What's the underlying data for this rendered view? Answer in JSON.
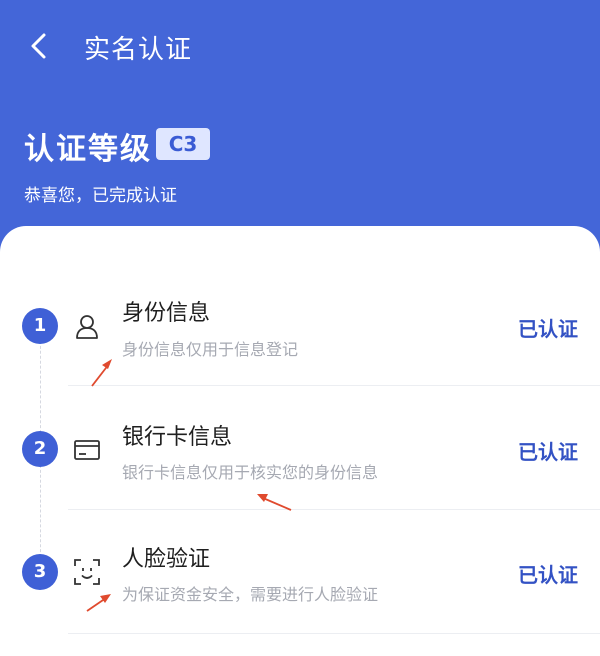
{
  "nav": {
    "title": "实名认证",
    "back_icon": "chevron-left-icon"
  },
  "level": {
    "title": "认证等级",
    "badge": "C3",
    "subtitle": "恭喜您，已完成认证"
  },
  "steps": [
    {
      "number": "1",
      "icon": "user-icon",
      "title": "身份信息",
      "description": "身份信息仅用于信息登记",
      "status": "已认证"
    },
    {
      "number": "2",
      "icon": "bank-card-icon",
      "title": "银行卡信息",
      "description": "银行卡信息仅用于核实您的身份信息",
      "status": "已认证"
    },
    {
      "number": "3",
      "icon": "face-scan-icon",
      "title": "人脸验证",
      "description": "为保证资金安全，需要进行人脸验证",
      "status": "已认证"
    }
  ],
  "colors": {
    "header_bg": "#4466d8",
    "accent": "#3352c4",
    "annotation_arrow": "#e04a2e"
  }
}
